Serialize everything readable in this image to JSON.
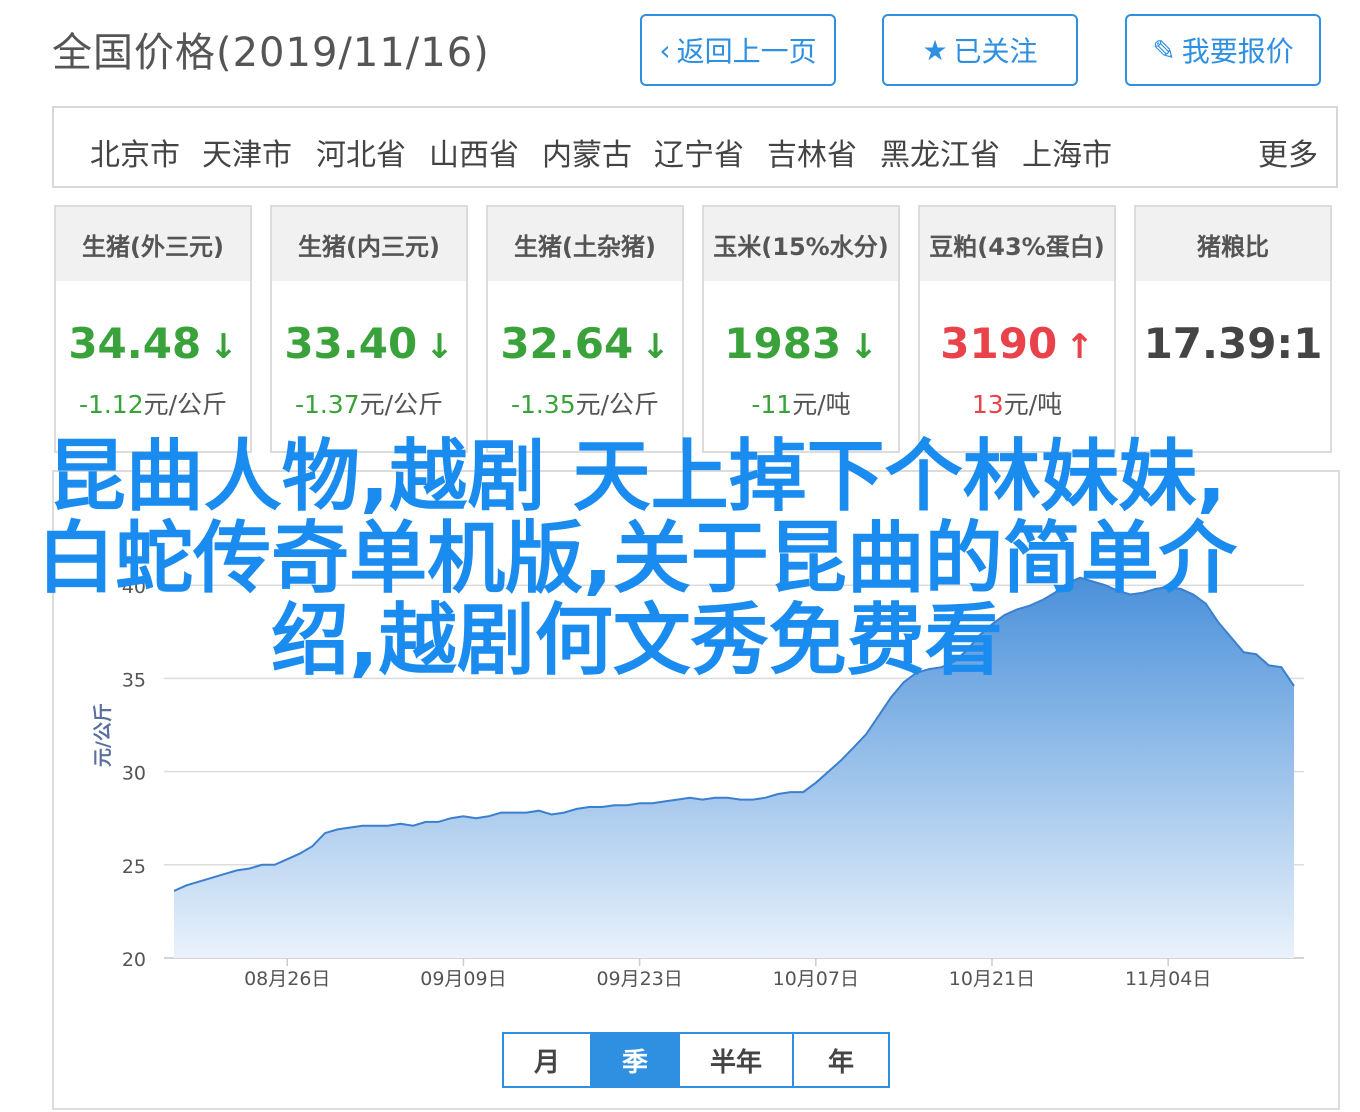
{
  "header": {
    "title": "全国价格(2019/11/16)",
    "back_label": "返回上一页",
    "follow_label": "已关注",
    "report_label": "我要报价"
  },
  "regions": {
    "items": [
      "北京市",
      "天津市",
      "河北省",
      "山西省",
      "内蒙古",
      "辽宁省",
      "吉林省",
      "黑龙江省",
      "上海市"
    ],
    "more_label": "更多"
  },
  "cards": [
    {
      "title": "生猪(外三元)",
      "value": "34.48",
      "arrow": "↓",
      "trend": "down",
      "change_num": "-1.12",
      "change_unit": "元/公斤"
    },
    {
      "title": "生猪(内三元)",
      "value": "33.40",
      "arrow": "↓",
      "trend": "down",
      "change_num": "-1.37",
      "change_unit": "元/公斤"
    },
    {
      "title": "生猪(土杂猪)",
      "value": "32.64",
      "arrow": "↓",
      "trend": "down",
      "change_num": "-1.35",
      "change_unit": "元/公斤"
    },
    {
      "title": "玉米(15%水分)",
      "value": "1983",
      "arrow": "↓",
      "trend": "down",
      "change_num": "-11",
      "change_unit": "元/吨"
    },
    {
      "title": "豆粕(43%蛋白)",
      "value": "3190",
      "arrow": "↑",
      "trend": "up",
      "change_num": "13",
      "change_unit": "元/吨"
    },
    {
      "title": "猪粮比",
      "value": "17.39:1",
      "arrow": "",
      "trend": "neutral",
      "change_num": "",
      "change_unit": ""
    }
  ],
  "overlay_title": "昆曲人物,越剧 天上掉下个林妹妹,白蛇传奇单机版,关于昆曲的简单介绍,越剧何文秀免费看",
  "colors": {
    "accent": "#2f8fe0",
    "down": "#3aa23a",
    "up": "#e9424a",
    "overlay": "#1a8cf0",
    "area_top": "#4a90d9",
    "area_bottom": "#eaf2fb"
  },
  "chart_data": {
    "type": "area",
    "ylabel": "元/公斤",
    "ylim": [
      20,
      45
    ],
    "yticks": [
      20,
      25,
      30,
      35,
      40
    ],
    "ytick_labels": [
      "20",
      "25",
      "30",
      "35",
      "40"
    ],
    "xtick_labels": [
      "08月26日",
      "09月09日",
      "09月23日",
      "10月07日",
      "10月21日",
      "11月04日"
    ],
    "xtick_positions": [
      9,
      23,
      37,
      51,
      65,
      79
    ],
    "grid": true,
    "series": [
      {
        "values": [
          23.6,
          23.9,
          24.1,
          24.3,
          24.5,
          24.7,
          24.8,
          25.0,
          25.0,
          25.3,
          25.6,
          26.0,
          26.7,
          26.9,
          27.0,
          27.1,
          27.1,
          27.1,
          27.2,
          27.1,
          27.3,
          27.3,
          27.5,
          27.6,
          27.5,
          27.6,
          27.8,
          27.8,
          27.8,
          27.9,
          27.7,
          27.8,
          28.0,
          28.1,
          28.1,
          28.2,
          28.2,
          28.3,
          28.3,
          28.4,
          28.5,
          28.6,
          28.5,
          28.6,
          28.6,
          28.5,
          28.5,
          28.6,
          28.8,
          28.9,
          28.9,
          29.4,
          30.0,
          30.6,
          31.3,
          32.0,
          33.0,
          34.0,
          34.8,
          35.3,
          35.5,
          35.6,
          35.9,
          36.5,
          37.3,
          37.9,
          38.4,
          38.7,
          38.9,
          39.2,
          39.6,
          40.1,
          40.4,
          40.2,
          40.0,
          39.7,
          39.5,
          39.6,
          39.8,
          39.9,
          39.8,
          39.5,
          39.0,
          38.0,
          37.2,
          36.4,
          36.3,
          35.7,
          35.6,
          34.6
        ]
      }
    ]
  },
  "periods": {
    "items": [
      "月",
      "季",
      "半年",
      "年"
    ],
    "active": "季"
  }
}
